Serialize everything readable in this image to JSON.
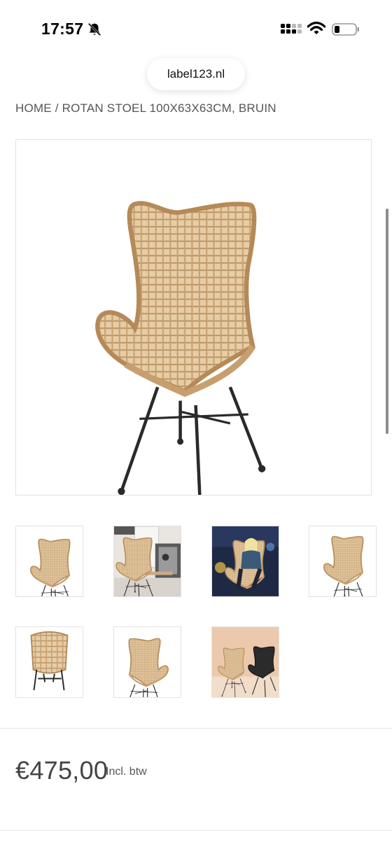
{
  "status_bar": {
    "time": "17:57",
    "icons": [
      "bell-slash-icon",
      "cellular-signal-icon",
      "wifi-icon",
      "battery-icon"
    ]
  },
  "browser": {
    "url": "label123.nl"
  },
  "breadcrumb": {
    "home": "HOME",
    "separator": "/",
    "current": "ROTAN STOEL 100X63X63CM, BRUIN"
  },
  "product": {
    "main_image": "rattan-egg-chair",
    "thumbnails": [
      "chair-angle-view",
      "chair-in-interior-scene",
      "woman-seated-in-chair",
      "chair-angle-view-2",
      "chair-front-view",
      "chair-side-view",
      "natural-and-black-chairs"
    ],
    "price": "€475,00",
    "vat_note": "Incl. btw"
  },
  "colors": {
    "rattan": "#c9a878",
    "rattan_dark": "#a8845a",
    "frame": "#2a2a2a",
    "text": "#555555"
  }
}
